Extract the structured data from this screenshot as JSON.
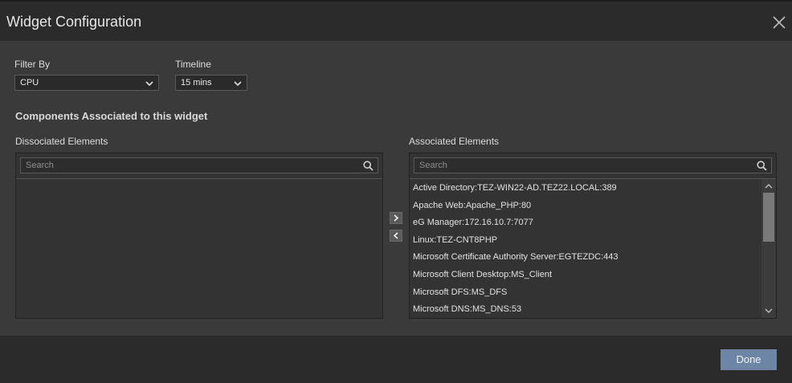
{
  "dialog": {
    "title": "Widget Configuration"
  },
  "filters": {
    "filter_by_label": "Filter By",
    "filter_by_value": "CPU",
    "timeline_label": "Timeline",
    "timeline_value": "15 mins"
  },
  "components_title": "Components Associated to this widget",
  "dissociated": {
    "label": "Dissociated Elements",
    "search_placeholder": "Search",
    "items": []
  },
  "associated": {
    "label": "Associated Elements",
    "search_placeholder": "Search",
    "items": [
      "Active Directory:TEZ-WIN22-AD.TEZ22.LOCAL:389",
      "Apache Web:Apache_PHP:80",
      "eG Manager:172.16.10.7:7077",
      "Linux:TEZ-CNT8PHP",
      "Microsoft Certificate Authority Server:EGTEZDC:443",
      "Microsoft Client Desktop:MS_Client",
      "Microsoft DFS:MS_DFS",
      "Microsoft DNS:MS_DNS:53"
    ]
  },
  "footer": {
    "done_label": "Done"
  }
}
